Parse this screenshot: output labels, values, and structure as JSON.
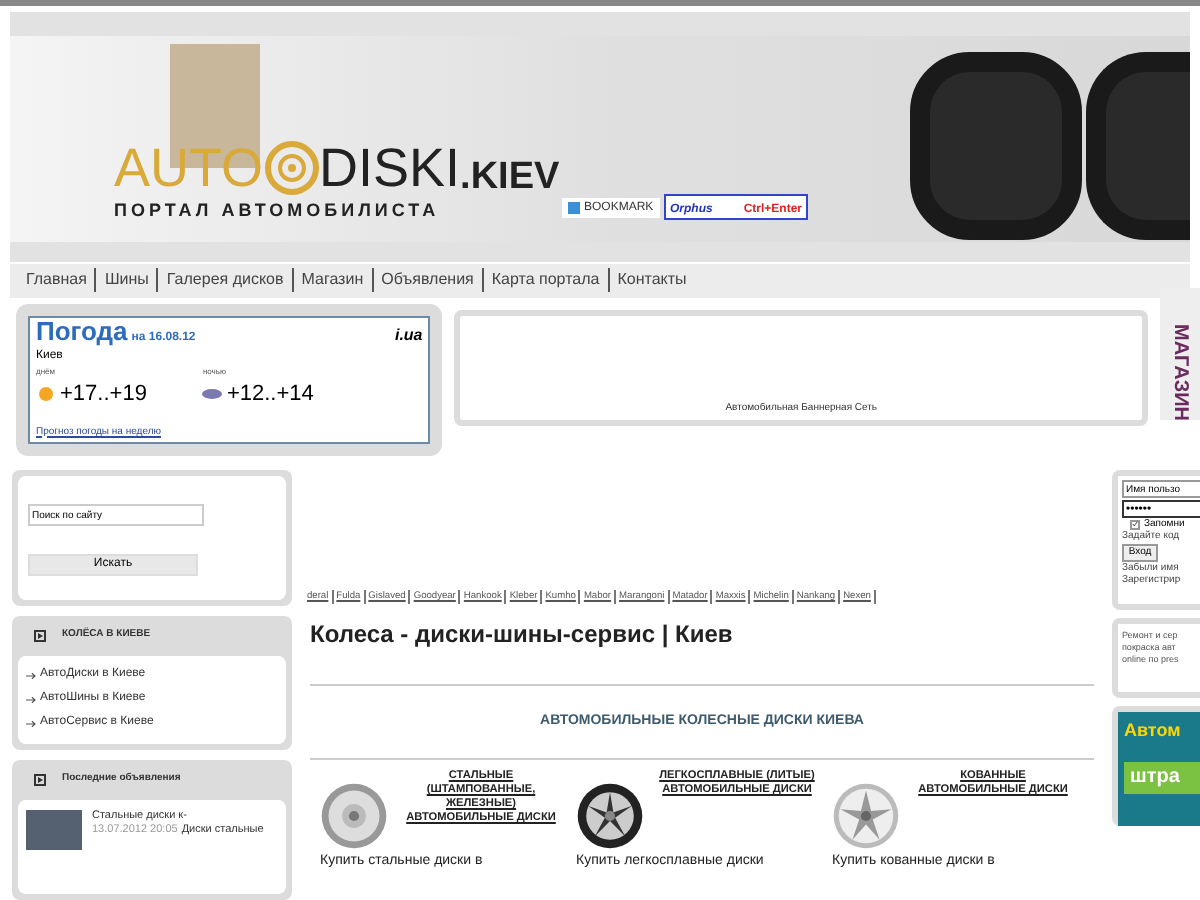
{
  "header": {
    "logo": {
      "part_1": "AUTO",
      "part_2": "DISKI",
      "suffix": ".KIEV",
      "tagline": "ПОРТАЛ АВТОМОБИЛИСТА"
    },
    "bookmark_button": "BOOKMARK",
    "orphus": {
      "label": "Orphus",
      "hotkey": "Ctrl+Enter"
    }
  },
  "nav": [
    "Главная",
    "Шины",
    "Галерея дисков",
    "Магазин",
    "Объявления",
    "Карта портала",
    "Контакты"
  ],
  "weather": {
    "title": "Погода",
    "date": "на 16.08.12",
    "source": "i.ua",
    "city": "Киев",
    "day": {
      "label": "днём",
      "temp": "+17..+19"
    },
    "night": {
      "label": "ночью",
      "temp": "+12..+14"
    },
    "link": "Прогноз погоды на неделю"
  },
  "banner_ad": {
    "caption": "Автомобильная Баннерная Сеть"
  },
  "side_tab": "МАГАЗИН",
  "search": {
    "value": "Поиск по сайту",
    "button": "Искать"
  },
  "wheels_section": {
    "title": "КОЛЁСА В КИЕВЕ",
    "items": [
      "АвтоДиски в Киеве",
      "АвтоШины в Киеве",
      "АвтоСервис в Киеве"
    ]
  },
  "ads_section": {
    "title": "Последние объявления",
    "item": {
      "title": "Стальные диски к-",
      "date": "13.07.2012 20:05",
      "category": "Диски стальные"
    }
  },
  "brands": [
    "deral",
    "Fulda",
    "Gislaved",
    "Goodyear",
    "Hankook",
    "Kleber",
    "Kumho",
    "Mabor",
    "Marangoni",
    "Matador",
    "Maxxis",
    "Michelin",
    "Nankang",
    "Nexen"
  ],
  "heading": "Колеса - диски-шины-сервис | Киев",
  "subheading": "АВТОМОБИЛЬНЫЕ КОЛЕСНЫЕ ДИСКИ КИЕВА",
  "disk_types": [
    {
      "title": "СТАЛЬНЫЕ (ШТАМПОВАННЫЕ, ЖЕЛЕЗНЫЕ) АВТОМОБИЛЬНЫЕ ДИСКИ",
      "text": "Купить стальные диски в",
      "kind": "steel"
    },
    {
      "title": "ЛЕГКОСПЛАВНЫЕ (ЛИТЫЕ) АВТОМОБИЛЬНЫЕ ДИСКИ",
      "text": "Купить легкосплавные диски",
      "kind": "alloy"
    },
    {
      "title": "КОВАННЫЕ АВТОМОБИЛЬНЫЕ ДИСКИ",
      "text": "Купить кованные диски в",
      "kind": "forged"
    }
  ],
  "login": {
    "username": "Имя пользо",
    "password": "••••••",
    "remember": {
      "label": "Запомни",
      "checked": true
    },
    "code_link": "Задайте код",
    "button": "Вход",
    "forgot_link": "Забыли имя",
    "register_link": "Зарегистрир"
  },
  "service_text": [
    "Ремонт и сер",
    "покраска авт",
    "online по pres"
  ],
  "promo": {
    "logo": "Автом",
    "button": "штра"
  }
}
